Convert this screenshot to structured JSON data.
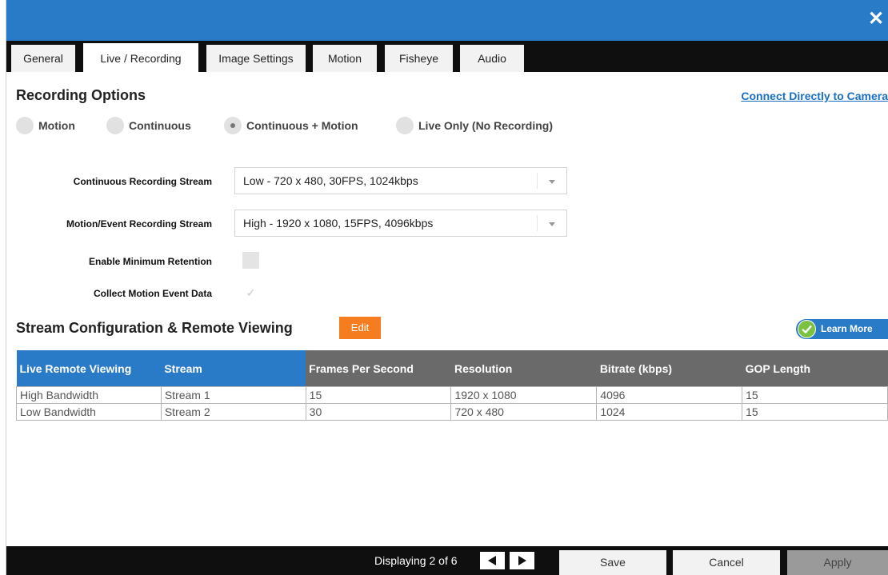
{
  "window": {
    "close_icon": "close-icon"
  },
  "tabs": [
    {
      "label": "General",
      "active": false
    },
    {
      "label": "Live / Recording",
      "active": true
    },
    {
      "label": "Image Settings",
      "active": false
    },
    {
      "label": "Motion",
      "active": false
    },
    {
      "label": "Fisheye",
      "active": false
    },
    {
      "label": "Audio",
      "active": false
    }
  ],
  "recording": {
    "title": "Recording Options",
    "connect_link": "Connect Directly to Camera",
    "options": [
      "Motion",
      "Continuous",
      "Continuous + Motion",
      "Live Only (No Recording)"
    ],
    "selected": "Continuous + Motion",
    "continuous_label": "Continuous Recording Stream",
    "continuous_value": "Low - 720 x 480, 30FPS, 1024kbps",
    "motion_label": "Motion/Event Recording Stream",
    "motion_value": "High - 1920 x 1080, 15FPS, 4096kbps",
    "min_retention_label": "Enable Minimum Retention",
    "min_retention_checked": false,
    "collect_motion_label": "Collect Motion Event Data",
    "collect_motion_checked": true
  },
  "stream_config": {
    "title": "Stream Configuration & Remote Viewing",
    "edit_label": "Edit",
    "learn_more_label": "Learn More",
    "headers": [
      "Live Remote Viewing",
      "Stream",
      "Frames Per Second",
      "Resolution",
      "Bitrate (kbps)",
      "GOP Length"
    ],
    "rows": [
      [
        "High Bandwidth",
        "Stream 1",
        "15",
        "1920 x 1080",
        "4096",
        "15"
      ],
      [
        "Low Bandwidth",
        "Stream 2",
        "30",
        "720 x 480",
        "1024",
        "15"
      ]
    ]
  },
  "footer": {
    "displaying": "Displaying 2 of 6",
    "save_label": "Save",
    "cancel_label": "Cancel",
    "apply_label": "Apply"
  },
  "colors": {
    "accent": "#2a7bc7",
    "edit": "#f57c1f",
    "learn_more_check": "#7cc242",
    "header_gray": "#6a6a6a"
  }
}
